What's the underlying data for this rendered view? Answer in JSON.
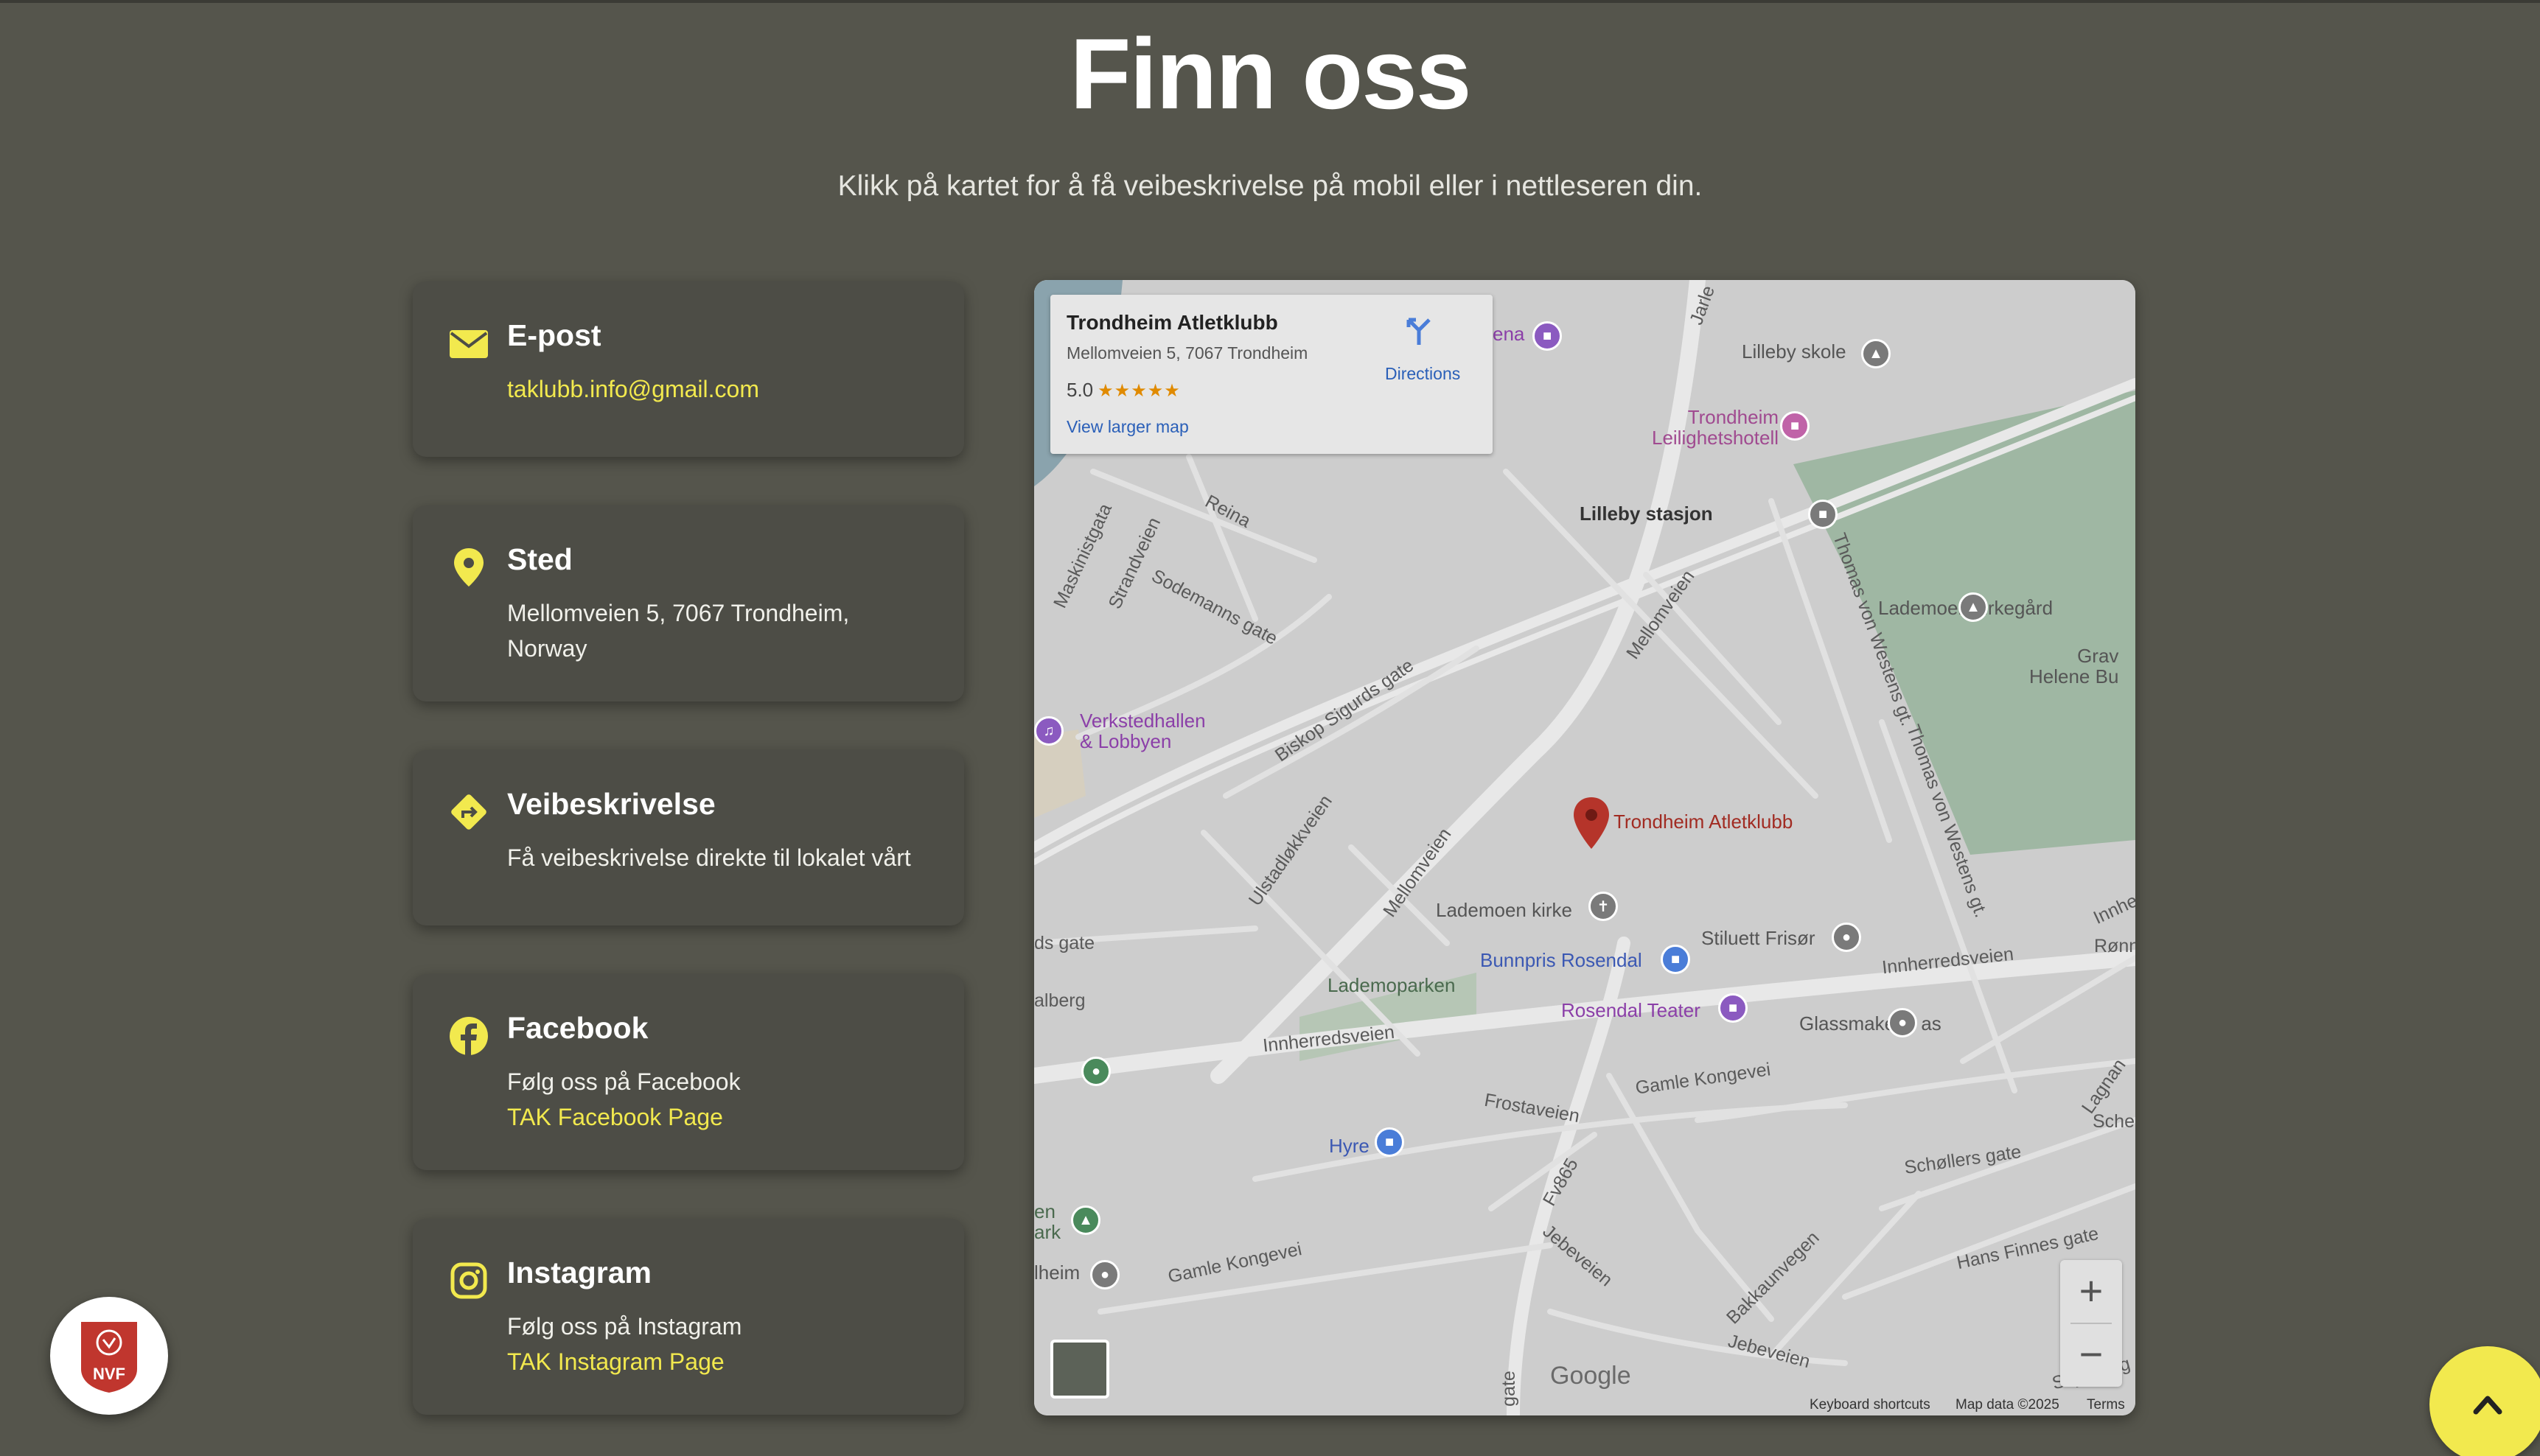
{
  "header": {
    "title": "Finn oss",
    "subtitle": "Klikk på kartet for å få veibeskrivelse på mobil eller i nettleseren din."
  },
  "cards": {
    "email": {
      "title": "E-post",
      "link": "taklubb.info@gmail.com",
      "icon": "envelope-icon"
    },
    "location": {
      "title": "Sted",
      "text": "Mellomveien 5, 7067 Trondheim, Norway",
      "icon": "map-pin-icon"
    },
    "directions": {
      "title": "Veibeskrivelse",
      "text": "Få veibeskrivelse direkte til lokalet vårt",
      "icon": "directions-icon"
    },
    "facebook": {
      "title": "Facebook",
      "text": "Følg oss på Facebook",
      "link": "TAK Facebook Page",
      "icon": "facebook-icon"
    },
    "instagram": {
      "title": "Instagram",
      "text": "Følg oss på Instagram",
      "link": "TAK Instagram Page",
      "icon": "instagram-icon"
    }
  },
  "map": {
    "info": {
      "name": "Trondheim Atletklubb",
      "address": "Mellomveien 5, 7067 Trondheim",
      "rating": "5.0",
      "stars": "★★★★★",
      "larger": "View larger map",
      "directions": "Directions"
    },
    "labels": {
      "lilleby_skole": "Lilleby skole",
      "leilighetshotell_1": "Trondheim",
      "leilighetshotell_2": "Leilighetshotell",
      "lilleby_stasjon": "Lilleby stasjon",
      "lademoen_kirkegard": "Lademoen kirkegård",
      "grav_1": "Grav",
      "grav_2": "Helene Bu",
      "reina": "Reina",
      "maskinistgata": "Maskinistgata",
      "strandveien": "Strandveien",
      "sodemanns": "Sodemanns gate",
      "verksted_1": "Verkstedhallen",
      "verksted_2": "& Lobbyen",
      "biskop": "Biskop Sigurds gate",
      "mellomveien_n": "Mellomveien",
      "thomas_1": "Thomas von Westens gt.",
      "thomas_2": "Thomas von Westens gt.",
      "marker": "Trondheim Atletklubb",
      "ulstad": "Ulstadløkkveien",
      "mellomveien_s": "Mellomveien",
      "lademoen_kirke": "Lademoen kirke",
      "stiluett": "Stiluett Frisør",
      "bunnpris": "Bunnpris Rosendal",
      "ds_gate": "ds gate",
      "lademoparken": "Lademoparken",
      "innherred_e": "Innherredsveien",
      "innhe": "Innhe",
      "ronn": "Rønn",
      "alberg": "alberg",
      "rosendal": "Rosendal Teater",
      "glassmakern": "Glassmaker'n as",
      "innherred_w": "Innherredsveien",
      "gamle_kongevei": "Gamle Kongevei",
      "frostaveien": "Frostaveien",
      "lagnan": "Lagnan",
      "schel": "Schel",
      "hyre": "Hyre",
      "fv865": "Fv865",
      "scholler": "Schøllers gate",
      "en_ark_1": "en",
      "en_ark_2": "ark",
      "heim": "lheim",
      "gamle_kongevei_w": "Gamle Kongevei",
      "jebeveien": "Jebeveien",
      "hans_finnes": "Hans Finnes gate",
      "bakkaunvegen": "Bakkaunvegen",
      "jebeveien_s": "Jebeveien",
      "gate": "gate",
      "skyds": "Skydsveg",
      "arena": "ena",
      "jarle": "Jarle"
    },
    "google": "Google",
    "attribution": {
      "shortcuts": "Keyboard shortcuts",
      "mapdata": "Map data ©2025",
      "terms": "Terms"
    },
    "zoom_in": "+",
    "zoom_out": "−"
  },
  "logo": {
    "text": "NVF"
  }
}
